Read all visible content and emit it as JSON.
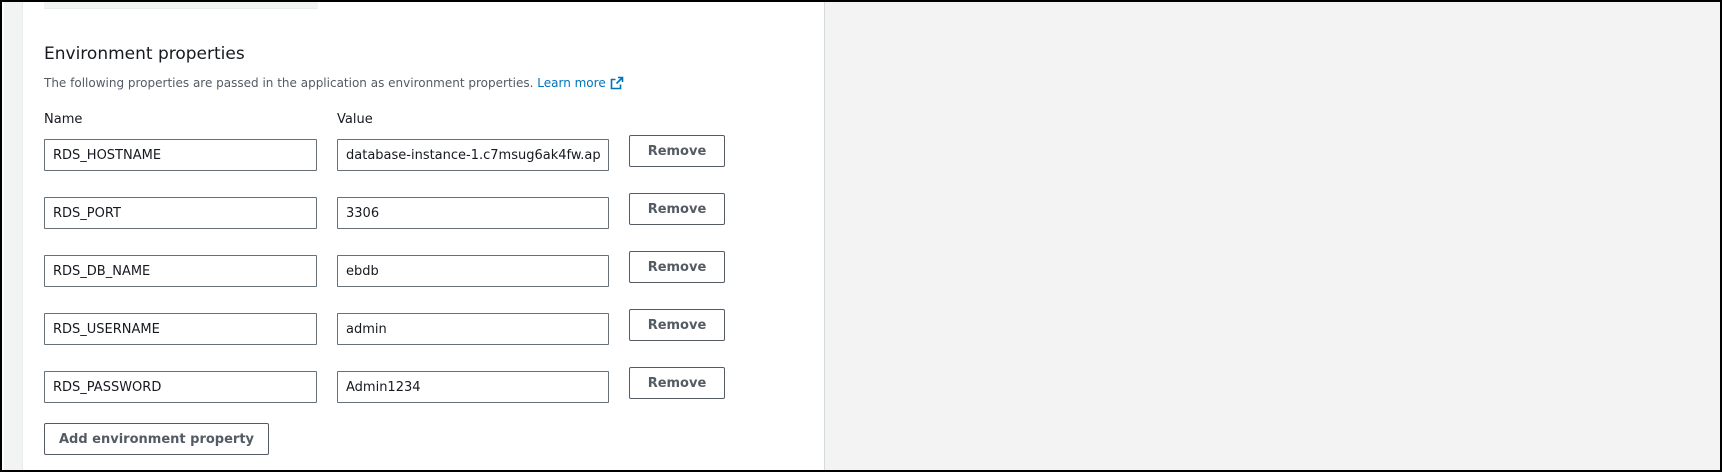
{
  "section": {
    "title": "Environment properties",
    "description": "The following properties are passed in the application as environment properties.",
    "learn_more": "Learn more"
  },
  "columns": {
    "name": "Name",
    "value": "Value"
  },
  "properties": [
    {
      "name": "RDS_HOSTNAME",
      "value": "database-instance-1.c7msug6ak4fw.ap-",
      "remove_label": "Remove"
    },
    {
      "name": "RDS_PORT",
      "value": "3306",
      "remove_label": "Remove"
    },
    {
      "name": "RDS_DB_NAME",
      "value": "ebdb",
      "remove_label": "Remove"
    },
    {
      "name": "RDS_USERNAME",
      "value": "admin",
      "remove_label": "Remove"
    },
    {
      "name": "RDS_PASSWORD",
      "value": "Admin1234",
      "remove_label": "Remove"
    }
  ],
  "add_button": "Add environment property",
  "icons": {
    "external_link": "external-link-icon"
  },
  "colors": {
    "link": "#0073bb",
    "text": "#16191f",
    "muted": "#545b64",
    "border": "#687078",
    "side_bg": "#f2f3f2"
  }
}
